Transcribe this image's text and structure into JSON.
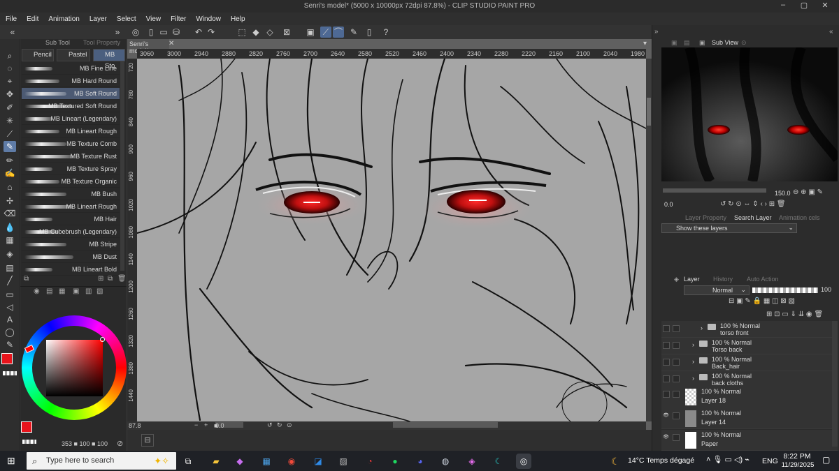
{
  "window": {
    "title": "Senri's model* (5000 x 10000px 72dpi 87.8%) - CLIP STUDIO PAINT PRO"
  },
  "menu": [
    "File",
    "Edit",
    "Animation",
    "Layer",
    "Select",
    "View",
    "Filter",
    "Window",
    "Help"
  ],
  "subtool": {
    "tabs": [
      "Sub Tool",
      "Tool Property"
    ],
    "categories": [
      "Pencil",
      "Pastel",
      "MB Sto"
    ],
    "brushes": [
      "MB Fine Line",
      "MB Hard Round",
      "MB Soft Round",
      "MB Textured Soft Round",
      "MB Lineart (Legendary)",
      "MB Lineart Rough",
      "MB Texture Comb",
      "MB Texture Rust",
      "MB Texture Spray",
      "MB Texture Organic",
      "MB Bush",
      "MB Lineart Rough",
      "MB Hair",
      "MB Cubebrush (Legendary)",
      "MB Stripe",
      "MB Dust",
      "MB Lineart Bold"
    ],
    "selected_index": 2
  },
  "color": {
    "main": "#e8141c",
    "values_label": "353",
    "s": "100",
    "v": "100"
  },
  "canvas": {
    "doc_tab": "Senri's model*",
    "hruler_ticks": [
      "3060",
      "3000",
      "2940",
      "2880",
      "2820",
      "2760",
      "2700",
      "2640",
      "2580",
      "2520",
      "2460",
      "2400",
      "2340",
      "2280",
      "2220",
      "2160",
      "2100",
      "2040",
      "1980"
    ],
    "vruler_ticks": [
      "720",
      "780",
      "840",
      "900",
      "960",
      "1020",
      "1080",
      "1140",
      "1200",
      "1260",
      "1320",
      "1380",
      "1440"
    ],
    "zoom": "87.8",
    "angle": "0.0"
  },
  "subview": {
    "tab": "Sub View",
    "zoom": "150.0",
    "rot": "0.0"
  },
  "search_layer": {
    "tabs": [
      "Layer Property",
      "Search Layer",
      "Animation cels"
    ],
    "filter": "Show these layers"
  },
  "layer_panel": {
    "tabs": [
      "Layer",
      "History",
      "Auto Action"
    ],
    "blend": "Normal",
    "opacity": "100",
    "layers": [
      {
        "mode": "100 % Normal",
        "name": "torso front",
        "type": "folder"
      },
      {
        "mode": "100 % Normal",
        "name": "Torso back",
        "type": "folder"
      },
      {
        "mode": "100 % Normal",
        "name": "Back_hair",
        "type": "folder"
      },
      {
        "mode": "100 % Normal",
        "name": "back cloths",
        "type": "folder"
      },
      {
        "mode": "100 % Normal",
        "name": "Layer 18",
        "type": "raster"
      },
      {
        "mode": "100 % Normal",
        "name": "Layer 14",
        "type": "raster"
      },
      {
        "mode": "100 % Normal",
        "name": "Paper",
        "type": "paper"
      }
    ]
  },
  "taskbar": {
    "search_placeholder": "Type here to search",
    "weather": "14°C  Temps dégagé",
    "lang": "ENG",
    "time": "8:22 PM",
    "date": "11/29/2025"
  }
}
